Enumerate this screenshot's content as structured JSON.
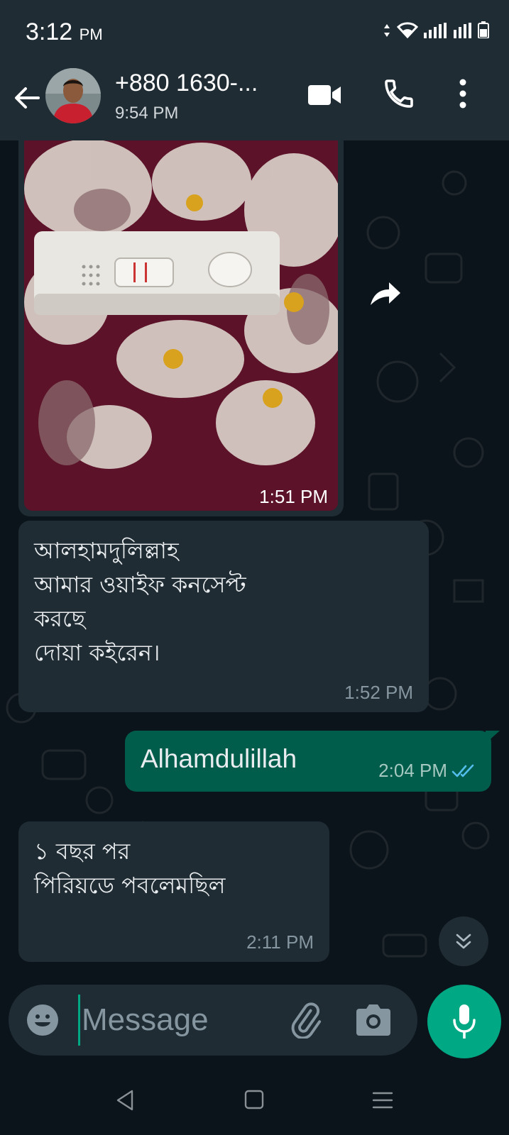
{
  "status_bar": {
    "time": "3:12",
    "ampm": "PM"
  },
  "header": {
    "contact_name": "+880 1630-...",
    "subtitle": "9:54 PM"
  },
  "messages": [
    {
      "type": "image",
      "direction": "incoming",
      "time": "1:51 PM"
    },
    {
      "type": "text",
      "direction": "incoming",
      "text": "আলহামদুলিল্লাহ\nআমার ওয়াইফ কনসেপ্ট\nকরছে\nদোয়া কইরেন।",
      "time": "1:52 PM"
    },
    {
      "type": "text",
      "direction": "outgoing",
      "text": "Alhamdulillah",
      "time": "2:04 PM",
      "status": "read"
    },
    {
      "type": "text",
      "direction": "incoming",
      "text": "১ বছর পর\nপিরিয়ডে পবলেমছিল",
      "time": "2:11 PM"
    }
  ],
  "composer": {
    "placeholder": "Message"
  },
  "colors": {
    "bg": "#0b141a",
    "header": "#1f2c34",
    "incoming": "#202c33",
    "outgoing": "#005c4b",
    "accent": "#00a884",
    "read_tick": "#53bdeb"
  }
}
